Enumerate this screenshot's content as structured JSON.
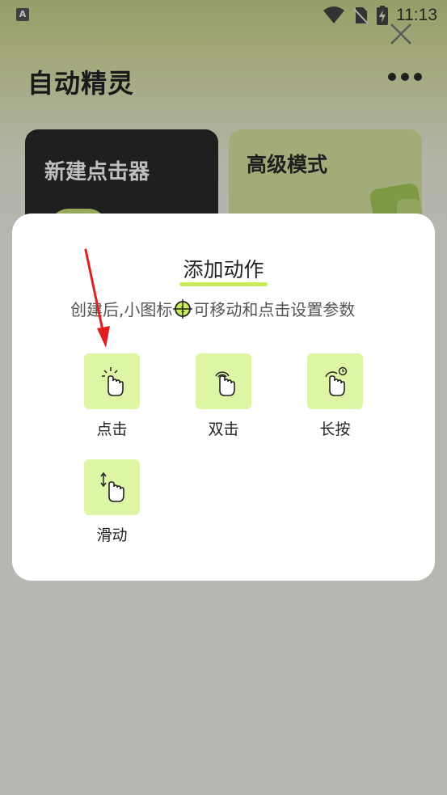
{
  "status_bar": {
    "time": "11:13",
    "app_badge": "A"
  },
  "app": {
    "title": "自动精灵"
  },
  "cards": {
    "new_clicker": "新建点击器",
    "advanced_mode": "高级模式"
  },
  "dialog": {
    "title": "添加动作",
    "subtitle_before": "创建后,小图标",
    "subtitle_after": "可移动和点击设置参数",
    "actions": [
      {
        "label": "点击",
        "icon": "tap-icon"
      },
      {
        "label": "双击",
        "icon": "double-tap-icon"
      },
      {
        "label": "长按",
        "icon": "long-press-icon"
      },
      {
        "label": "滑动",
        "icon": "swipe-icon"
      }
    ]
  },
  "colors": {
    "accent": "#c8ef5a",
    "tile_bg": "#dcf6a6",
    "dark_card": "#2a2a2a",
    "annotation_arrow": "#e02020"
  }
}
